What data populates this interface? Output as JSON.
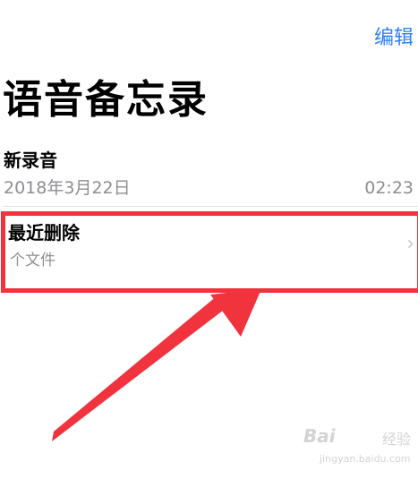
{
  "header": {
    "edit_label": "编辑",
    "page_title": "语音备忘录"
  },
  "recording": {
    "title": "新录音",
    "date": "2018年3月22日",
    "duration": "02:23"
  },
  "recently_deleted": {
    "title": "最近删除",
    "file_count": "个文件",
    "chevron": "›"
  },
  "annotation": {
    "highlight_color": "#f0333d",
    "arrow_color": "#f0333d"
  },
  "watermark": {
    "text": "Bai",
    "text2": "经验",
    "sub": "jingyan.baidu.com"
  }
}
